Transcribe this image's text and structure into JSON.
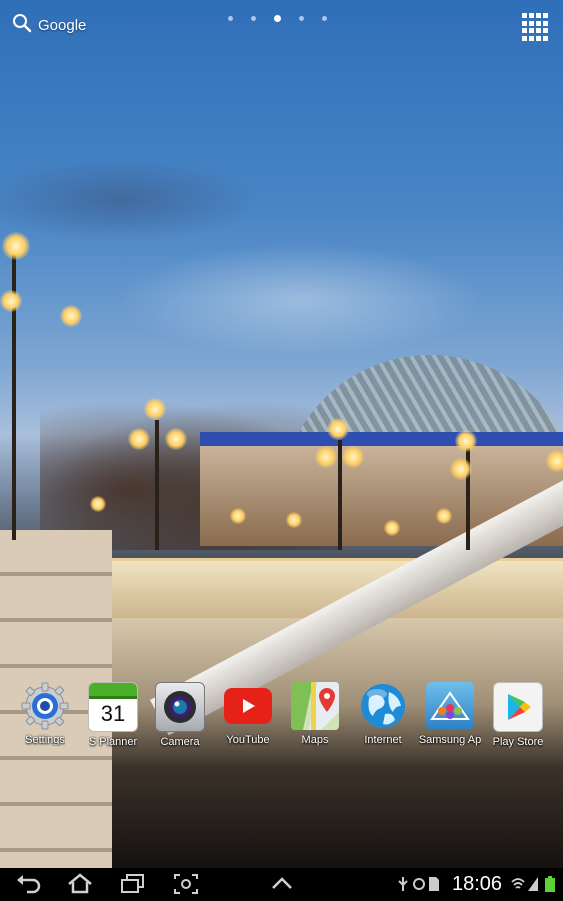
{
  "search": {
    "label": "Google",
    "icon": "search-icon"
  },
  "pages": {
    "count": 5,
    "active_index": 2
  },
  "apps_button": {
    "icon": "apps-grid-icon"
  },
  "dock": [
    {
      "label": "Settings",
      "icon": "settings-gear-icon"
    },
    {
      "label": "S Planner",
      "icon": "calendar-icon",
      "day": "31"
    },
    {
      "label": "Camera",
      "icon": "camera-icon"
    },
    {
      "label": "YouTube",
      "icon": "youtube-play-icon"
    },
    {
      "label": "Maps",
      "icon": "maps-pin-icon"
    },
    {
      "label": "Internet",
      "icon": "globe-icon"
    },
    {
      "label": "Samsung Ap",
      "icon": "samsung-apps-icon"
    },
    {
      "label": "Play Store",
      "icon": "play-store-icon"
    }
  ],
  "navbar": {
    "back": "back-icon",
    "home": "home-icon",
    "recents": "recent-apps-icon",
    "screenshot": "screenshot-icon",
    "menu": "up-arrow-icon"
  },
  "status": {
    "time": "18:06",
    "icons": [
      "usb-icon",
      "sync-icon",
      "wifi-icon",
      "signal-icon",
      "battery-icon"
    ]
  },
  "colors": {
    "youtube_red": "#e62117",
    "settings_blue": "#2b6fd6",
    "battery_green": "#5fd135"
  }
}
